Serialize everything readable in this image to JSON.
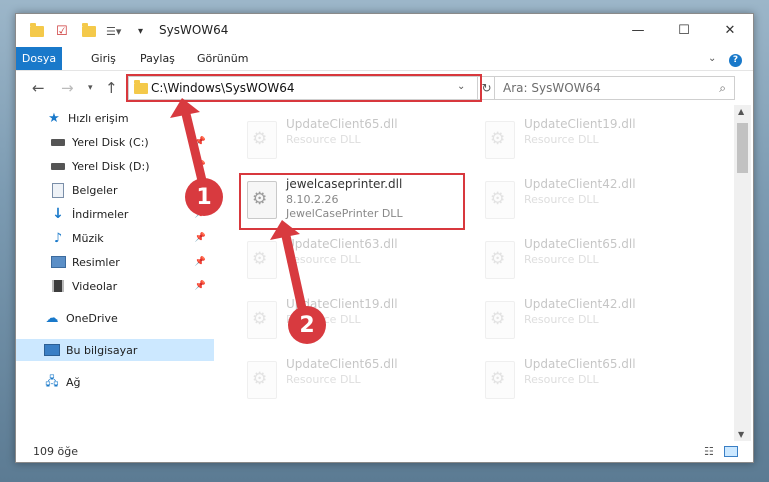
{
  "window": {
    "title": "SysWOW64"
  },
  "ribbon": {
    "tabs": [
      "Dosya",
      "Giriş",
      "Paylaş",
      "Görünüm"
    ]
  },
  "nav": {
    "address": "C:\\Windows\\SysWOW64",
    "search_placeholder": "Ara: SysWOW64"
  },
  "sidebar": {
    "items": [
      {
        "label": "Hızlı erişim"
      },
      {
        "label": "Yerel Disk (C:)"
      },
      {
        "label": "Yerel Disk (D:)"
      },
      {
        "label": "Belgeler"
      },
      {
        "label": "İndirmeler"
      },
      {
        "label": "Müzik"
      },
      {
        "label": "Resimler"
      },
      {
        "label": "Videolar"
      },
      {
        "label": "OneDrive"
      },
      {
        "label": "Bu bilgisayar"
      },
      {
        "label": "Ağ"
      }
    ]
  },
  "files": {
    "highlighted": {
      "name": "jewelcaseprinter.dll",
      "version": "8.10.2.26",
      "description": "JewelCasePrinter DLL"
    },
    "faded": [
      {
        "name": "UpdateClient65.dll",
        "desc": "Resource DLL"
      },
      {
        "name": "UpdateClient19.dll",
        "desc": "Resource DLL"
      },
      {
        "name": "UpdateClient42.dll",
        "desc": "Resource DLL"
      },
      {
        "name": "UpdateClient63.dll",
        "desc": "Resource DLL"
      },
      {
        "name": "UpdateClient65.dll",
        "desc": "Resource DLL"
      },
      {
        "name": "UpdateClient19.dll",
        "desc": "Resource DLL"
      },
      {
        "name": "UpdateClient42.dll",
        "desc": "Resource DLL"
      },
      {
        "name": "UpdateClient65.dll",
        "desc": "Resource DLL"
      },
      {
        "name": "UpdateClient65.dll",
        "desc": "Resource DLL"
      }
    ]
  },
  "status": {
    "count": "109 öğe"
  },
  "markers": [
    "1",
    "2"
  ],
  "colors": {
    "accent": "#1979ca",
    "highlight": "#d8383d",
    "selected": "#cce8ff"
  }
}
